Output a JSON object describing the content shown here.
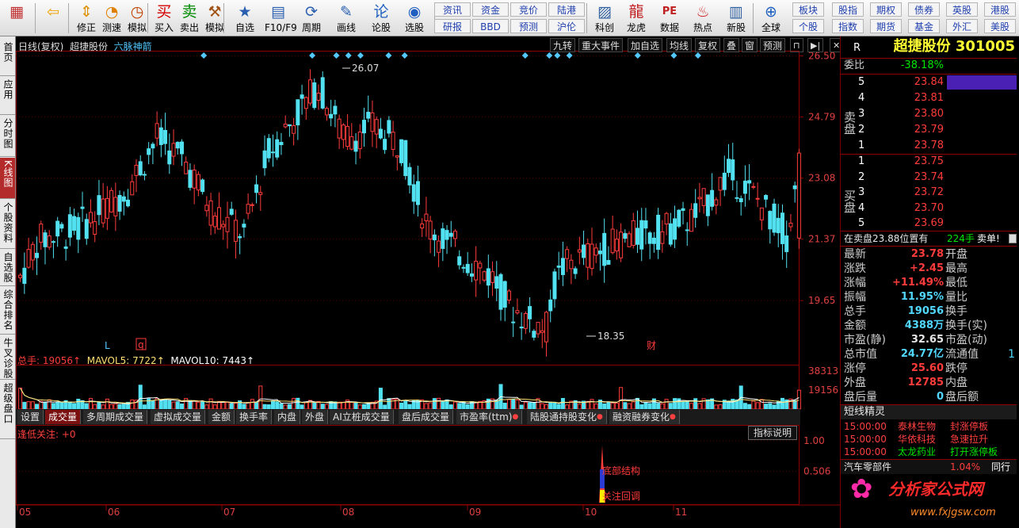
{
  "toolbar": {
    "big": [
      {
        "label": "",
        "icon": "app-icon"
      },
      {
        "label": "",
        "icon": "back-arrow-icon"
      },
      {
        "label": "修正",
        "icon": "up-down-arrow-icon"
      },
      {
        "label": "测速",
        "icon": "speed-icon"
      },
      {
        "label": "模拟",
        "icon": "clock-icon"
      },
      {
        "label": "买入",
        "icon": "buy-icon",
        "glyph": "买"
      },
      {
        "label": "卖出",
        "icon": "sell-icon",
        "glyph": "卖"
      },
      {
        "label": "模拟",
        "icon": "hammer-icon"
      },
      {
        "label": "自选",
        "icon": "star-folder-icon"
      },
      {
        "label": "F10/F9",
        "icon": "window-icon"
      },
      {
        "label": "周期",
        "icon": "cycle-icon"
      },
      {
        "label": "画线",
        "icon": "pencil-icon"
      },
      {
        "label": "论股",
        "icon": "discuss-icon"
      },
      {
        "label": "选股",
        "icon": "screen-icon"
      }
    ],
    "small_left": [
      [
        "资讯",
        "资金",
        "竞价",
        "陆港"
      ],
      [
        "研报",
        "BBD",
        "预测",
        "沪伦"
      ]
    ],
    "big2": [
      {
        "label": "科创",
        "icon": "chart-icon"
      },
      {
        "label": "龙虎",
        "icon": "dragon-icon"
      },
      {
        "label": "数据",
        "icon": "pe-icon"
      },
      {
        "label": "热点",
        "icon": "hot-icon"
      },
      {
        "label": "新股",
        "icon": "ipo-icon"
      },
      {
        "label": "全球",
        "icon": "globe-icon"
      }
    ],
    "small_right": [
      [
        "板块",
        "股指",
        "期权",
        "债券",
        "英股",
        "港股"
      ],
      [
        "个股",
        "指数",
        "期货",
        "基金",
        "外汇",
        "美股"
      ]
    ]
  },
  "left_tabs": [
    {
      "label": "首页",
      "active": false
    },
    {
      "label": "应用",
      "active": false
    },
    {
      "label": "分时图",
      "active": false
    },
    {
      "label": "K线图",
      "active": true
    },
    {
      "label": "个股资料",
      "active": false
    },
    {
      "label": "自选股",
      "active": false
    },
    {
      "label": "综合排名",
      "active": false
    },
    {
      "label": "牛叉诊股",
      "active": false
    },
    {
      "label": "超级盘口",
      "active": false
    }
  ],
  "chart_header": {
    "period": "日线(复权)",
    "stock": "超捷股份",
    "indicator": "六脉神箭",
    "buttons": [
      "九转",
      "重大事件",
      "加自选",
      "均线",
      "复权",
      "叠",
      "窗",
      "预测"
    ]
  },
  "y_axis_labels": [
    "26.50",
    "24.79",
    "23.08",
    "21.37",
    "19.65"
  ],
  "volume_axis": [
    "38313",
    "19156"
  ],
  "indicator_axis": [
    "1.00",
    "0.506"
  ],
  "x_axis_labels": [
    "05",
    "06",
    "07",
    "08",
    "09",
    "10",
    "11"
  ],
  "annotations": {
    "high_label": "26.07",
    "low_label": "18.35",
    "marker_L": "L",
    "marker_q": "q",
    "marker_cai": "财",
    "signal1": "底部结构",
    "signal2": "关注回调"
  },
  "volume_header": {
    "total": "总手: 19056↑",
    "mavol5": "MAVOL5: 7722↑",
    "mavol10": "MAVOL10: 7443↑"
  },
  "bottom_tabs": [
    {
      "label": "设置",
      "active": false,
      "dot": false
    },
    {
      "label": "成交量",
      "active": true,
      "dot": false
    },
    {
      "label": "多周期成交量",
      "active": false,
      "dot": false
    },
    {
      "label": "虚拟成交量",
      "active": false,
      "dot": false
    },
    {
      "label": "金额",
      "active": false,
      "dot": false
    },
    {
      "label": "换手率",
      "active": false,
      "dot": false
    },
    {
      "label": "内盘",
      "active": false,
      "dot": false
    },
    {
      "label": "外盘",
      "active": false,
      "dot": false
    },
    {
      "label": "AI立桩成交量",
      "active": false,
      "dot": false
    },
    {
      "label": "盘后成交量",
      "active": false,
      "dot": false
    },
    {
      "label": "市盈率(ttm)",
      "active": false,
      "dot": true
    },
    {
      "label": "陆股通持股变化",
      "active": false,
      "dot": true
    },
    {
      "label": "融资融券变化",
      "active": false,
      "dot": true
    }
  ],
  "indicator_panel": {
    "title": "逢低关注: +0",
    "help_button": "指标说明"
  },
  "right_panel": {
    "r_tag": "R",
    "stock_name": "超捷股份 301005",
    "weibi_label": "委比",
    "weibi": "-38.18%",
    "sell_group_label": "卖盘",
    "buy_group_label": "买盘",
    "sell": [
      {
        "n": "5",
        "price": "23.84",
        "vol": ""
      },
      {
        "n": "4",
        "price": "23.81",
        "vol": ""
      },
      {
        "n": "3",
        "price": "23.80",
        "vol": ""
      },
      {
        "n": "2",
        "price": "23.79",
        "vol": ""
      },
      {
        "n": "1",
        "price": "23.78",
        "vol": ""
      }
    ],
    "buy": [
      {
        "n": "1",
        "price": "23.75",
        "vol": ""
      },
      {
        "n": "2",
        "price": "23.74",
        "vol": ""
      },
      {
        "n": "3",
        "price": "23.72",
        "vol": ""
      },
      {
        "n": "4",
        "price": "23.70",
        "vol": ""
      },
      {
        "n": "5",
        "price": "23.69",
        "vol": ""
      }
    ],
    "trade_note": "在卖盘23.88位置有",
    "trade_vol": "224手",
    "trade_side": "卖单!",
    "stats": [
      {
        "l1": "最新",
        "v1": "23.78",
        "c1": "red",
        "l2": "开盘",
        "v2": ""
      },
      {
        "l1": "涨跌",
        "v1": "+2.45",
        "c1": "red",
        "l2": "最高",
        "v2": ""
      },
      {
        "l1": "涨幅",
        "v1": "+11.49%",
        "c1": "red",
        "l2": "最低",
        "v2": ""
      },
      {
        "l1": "振幅",
        "v1": "11.95%",
        "c1": "cyan",
        "l2": "量比",
        "v2": ""
      },
      {
        "l1": "总手",
        "v1": "19056",
        "c1": "cyan",
        "l2": "换手",
        "v2": ""
      },
      {
        "l1": "金额",
        "v1": "4388万",
        "c1": "cyan",
        "l2": "换手(实)",
        "v2": ""
      },
      {
        "l1": "市盈(静)",
        "v1": "32.65",
        "c1": "white",
        "l2": "市盈(动)",
        "v2": ""
      },
      {
        "l1": "总市值",
        "v1": "24.77亿",
        "c1": "cyan",
        "l2": "流通值",
        "v2": "1"
      },
      {
        "l1": "涨停",
        "v1": "25.60",
        "c1": "red",
        "l2": "跌停",
        "v2": ""
      },
      {
        "l1": "外盘",
        "v1": "12785",
        "c1": "red",
        "l2": "内盘",
        "v2": ""
      },
      {
        "l1": "盘后量",
        "v1": "0",
        "c1": "cyan",
        "l2": "盘后额",
        "v2": ""
      }
    ],
    "elf_title": "短线精灵",
    "elf": [
      {
        "time": "15:00:00",
        "name": "泰林生物",
        "event": "封涨停板"
      },
      {
        "time": "15:00:00",
        "name": "华依科技",
        "event": "急速拉升"
      },
      {
        "time": "15:00:00",
        "name": "太龙药业",
        "event": "打开涨停板"
      }
    ],
    "sector_name": "汽车零部件",
    "sector_pct": "1.04%",
    "tongxing": "同行",
    "watermark": "分析家公式网",
    "watermark_url": "www.fxjgsw.com"
  },
  "colors": {
    "up": "#ff3c3c",
    "down": "#52e1f0",
    "frame": "#8b0000",
    "ma_white": "#ffffff",
    "ma_yellow": "#ffe070"
  }
}
